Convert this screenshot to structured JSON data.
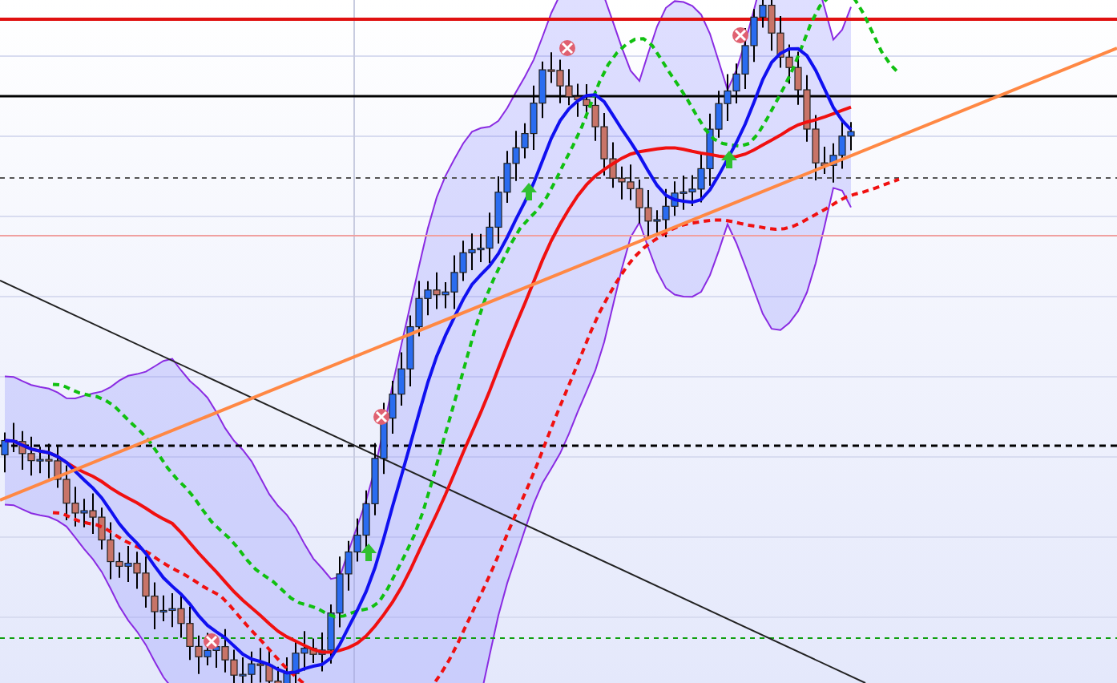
{
  "chart": {
    "kind": "candlestick"
  }
}
